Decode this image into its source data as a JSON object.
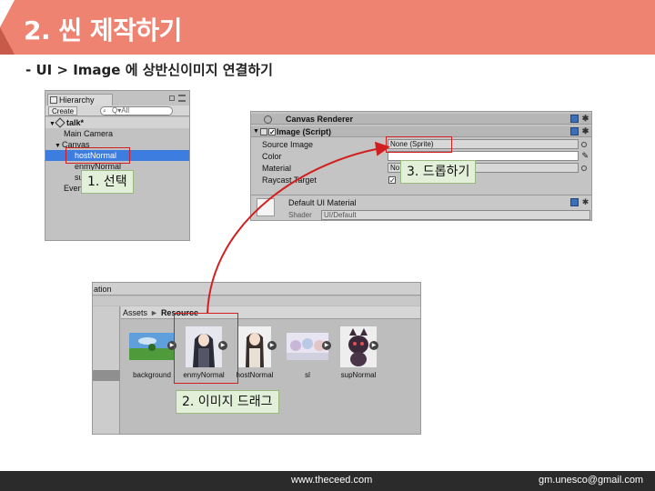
{
  "slide": {
    "title": "2. 씬 제작하기",
    "subtitle": "- UI > Image 에 상반신이미지 연결하기",
    "footer_website": "www.theceed.com",
    "footer_email": "gm.unesco@gmail.com",
    "accent_color": "#ef8372"
  },
  "hierarchy": {
    "tab_label": "Hierarchy",
    "create_label": "Create",
    "search_placeholder": "Q▾All",
    "scene_name": "talk*",
    "items": [
      {
        "label": "Main Camera"
      },
      {
        "label": "Canvas"
      },
      {
        "label": "hostNormal",
        "selected": true
      },
      {
        "label": "enmyNormal"
      },
      {
        "label": "su"
      },
      {
        "label": "Even"
      }
    ]
  },
  "inspector": {
    "canvas_renderer_label": "Canvas Renderer",
    "image_component_label": "Image (Script)",
    "properties": [
      {
        "label": "Source Image",
        "value": "None (Sprite)"
      },
      {
        "label": "Color",
        "value": ""
      },
      {
        "label": "Material",
        "value": "No"
      },
      {
        "label": "Raycast Target",
        "value": "✓"
      }
    ],
    "material_name": "Default UI Material",
    "shader_label": "Shader",
    "shader_value": "UI/Default"
  },
  "project": {
    "tab_label": "ation",
    "breadcrumb_root": "Assets",
    "breadcrumb_sep": "►",
    "breadcrumb_current": "Resource",
    "assets": [
      {
        "name": "background",
        "icon": "landscape-thumbnail"
      },
      {
        "name": "enmyNormal",
        "icon": "character-thumbnail"
      },
      {
        "name": "hostNormal",
        "icon": "character-thumbnail"
      },
      {
        "name": "sl",
        "icon": "group-thumbnail"
      },
      {
        "name": "supNormal",
        "icon": "creature-thumbnail"
      }
    ]
  },
  "callouts": {
    "step1": "1. 선택",
    "step2": "2. 이미지 드래그",
    "step3": "3. 드롭하기"
  }
}
